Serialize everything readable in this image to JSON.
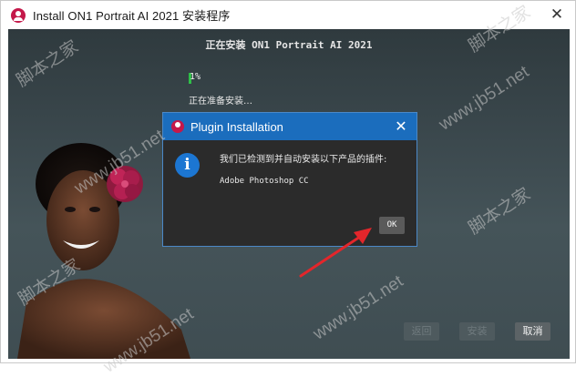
{
  "window": {
    "title": "Install ON1 Portrait AI 2021 安装程序",
    "close_glyph": "✕"
  },
  "installer": {
    "heading": "正在安装 ON1 Portrait AI 2021",
    "progress_percent": 1,
    "progress_text": "1%",
    "status": "正在准备安装…",
    "buttons": {
      "back": "返回",
      "install": "安装",
      "cancel": "取消"
    }
  },
  "dialog": {
    "title": "Plugin Installation",
    "close_glyph": "✕",
    "info_glyph": "i",
    "message": "我们已检测到并自动安装以下产品的插件:",
    "product": "Adobe Photoshop CC",
    "ok_label": "OK"
  },
  "watermarks": [
    "脚本之家",
    "www.jb51.net",
    "脚本之家",
    "www.jb51.net",
    "脚本之家",
    "www.jb51.net",
    "脚本之家",
    "www.jb51.net"
  ],
  "colors": {
    "accent_blue": "#1b6dbd",
    "progress_green": "#2fbf48",
    "annotation_arrow": "#e3262b",
    "app_icon": "#c4184a"
  },
  "icons": [
    "on1-app-icon",
    "close-icon",
    "info-icon",
    "annotation-arrow"
  ]
}
